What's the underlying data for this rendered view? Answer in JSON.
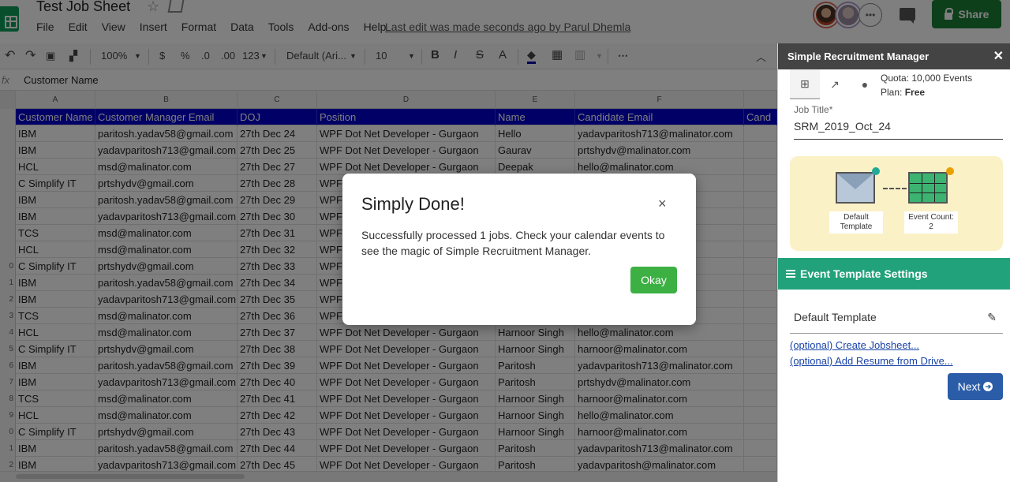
{
  "header": {
    "doc_title": "Test Job Sheet",
    "menu": [
      "File",
      "Edit",
      "View",
      "Insert",
      "Format",
      "Data",
      "Tools",
      "Add-ons",
      "Help"
    ],
    "last_edit": "Last edit was made seconds ago by Parul Dhemla",
    "share_label": "Share"
  },
  "toolbar": {
    "zoom": "100%",
    "currency": "$",
    "percent": "%",
    "dec_less": ".0",
    "dec_more": ".00",
    "format_more": "123",
    "font": "Default (Ari...",
    "font_size": "10",
    "bold": "B",
    "italic": "I",
    "strike": "S",
    "text_color": "A"
  },
  "formula_bar": {
    "fx": "fx",
    "value": "Customer Name"
  },
  "sheet": {
    "columns": [
      "A",
      "B",
      "C",
      "D",
      "E",
      "F"
    ],
    "header": [
      "Customer Name",
      "Customer Manager Email",
      "DOJ",
      "Position",
      "Name",
      "Candidate Email",
      "Cand"
    ],
    "row_numbers": [
      "",
      "",
      "",
      "",
      "",
      "",
      "",
      "",
      "",
      "0",
      "1",
      "2",
      "3",
      "4",
      "5",
      "6",
      "7",
      "8",
      "9",
      "0",
      "1",
      "2"
    ],
    "rows": [
      [
        "IBM",
        "paritosh.yadav58@gmail.com",
        "27th Dec 24",
        "WPF Dot Net Developer - Gurgaon",
        "Hello",
        "yadavparitosh713@malinator.com"
      ],
      [
        "IBM",
        "yadavparitosh713@gmail.com",
        "27th Dec 25",
        "WPF Dot Net Developer - Gurgaon",
        "Gaurav",
        "prtshydv@malinator.com"
      ],
      [
        "HCL",
        "msd@malinator.com",
        "27th Dec 27",
        "WPF Dot Net Developer - Gurgaon",
        "Deepak",
        "hello@malinator.com"
      ],
      [
        "C Simplify IT",
        "prtshydv@gmail.com",
        "27th Dec 28",
        "WPF",
        "",
        ""
      ],
      [
        "IBM",
        "paritosh.yadav58@gmail.com",
        "27th Dec 29",
        "WPF",
        "",
        "tor.com"
      ],
      [
        "IBM",
        "yadavparitosh713@gmail.com",
        "27th Dec 30",
        "WPF",
        "",
        ""
      ],
      [
        "TCS",
        "msd@malinator.com",
        "27th Dec 31",
        "WPF",
        "",
        ""
      ],
      [
        "HCL",
        "msd@malinator.com",
        "27th Dec 32",
        "WPF",
        "",
        ""
      ],
      [
        "C Simplify IT",
        "prtshydv@gmail.com",
        "27th Dec 33",
        "WPF",
        "",
        ""
      ],
      [
        "IBM",
        "paritosh.yadav58@gmail.com",
        "27th Dec 34",
        "WPF",
        "",
        "tor.com"
      ],
      [
        "IBM",
        "yadavparitosh713@gmail.com",
        "27th Dec 35",
        "WPF",
        "",
        ""
      ],
      [
        "TCS",
        "msd@malinator.com",
        "27th Dec 36",
        "WPF",
        "",
        ""
      ],
      [
        "HCL",
        "msd@malinator.com",
        "27th Dec 37",
        "WPF Dot Net Developer - Gurgaon",
        "Harnoor Singh",
        "hello@malinator.com"
      ],
      [
        "C Simplify IT",
        "prtshydv@gmail.com",
        "27th Dec 38",
        "WPF Dot Net Developer - Gurgaon",
        "Harnoor Singh",
        "harnoor@malinator.com"
      ],
      [
        "IBM",
        "paritosh.yadav58@gmail.com",
        "27th Dec 39",
        "WPF Dot Net Developer - Gurgaon",
        "Paritosh",
        "yadavparitosh713@malinator.com"
      ],
      [
        "IBM",
        "yadavparitosh713@gmail.com",
        "27th Dec 40",
        "WPF Dot Net Developer - Gurgaon",
        "Paritosh",
        "prtshydv@malinator.com"
      ],
      [
        "TCS",
        "msd@malinator.com",
        "27th Dec 41",
        "WPF Dot Net Developer - Gurgaon",
        "Harnoor Singh",
        "harnoor@malinator.com"
      ],
      [
        "HCL",
        "msd@malinator.com",
        "27th Dec 42",
        "WPF Dot Net Developer - Gurgaon",
        "Harnoor Singh",
        "hello@malinator.com"
      ],
      [
        "C Simplify IT",
        "prtshydv@gmail.com",
        "27th Dec 43",
        "WPF Dot Net Developer - Gurgaon",
        "Harnoor Singh",
        "harnoor@malinator.com"
      ],
      [
        "IBM",
        "paritosh.yadav58@gmail.com",
        "27th Dec 44",
        "WPF Dot Net Developer - Gurgaon",
        "Paritosh",
        "yadavparitosh713@malinator.com"
      ],
      [
        "IBM",
        "yadavparitosh713@gmail.com",
        "27th Dec 45",
        "WPF Dot Net Developer - Gurgaon",
        "Paritosh",
        "yadavparitosh@malinator.com"
      ]
    ]
  },
  "sidebar": {
    "title": "Simple Recruitment Manager",
    "quota": "Quota: 10,000 Events",
    "plan_label": "Plan:",
    "plan_value": "Free",
    "job_title_label": "Job Title*",
    "job_title_value": "SRM_2019_Oct_24",
    "default_template_caption": "Default Template",
    "event_count_caption": "Event Count: 2",
    "event_settings_label": "Event Template Settings",
    "template_name": "Default Template",
    "link_jobsheet": "(optional) Create Jobsheet...",
    "link_resume": "(optional) Add Resume from Drive...",
    "next_label": "Next"
  },
  "modal": {
    "title": "Simply Done!",
    "close_glyph": "×",
    "message": "Successfully processed 1 jobs. Check your calendar events to see the magic of Simple Recruitment Manager.",
    "okay_label": "Okay"
  },
  "colors": {
    "header_row_bg": "#0000cc",
    "share_green": "#1a7f37",
    "okay_green": "#3cb043",
    "settings_teal": "#22a27a",
    "next_blue": "#2a5ca8"
  }
}
